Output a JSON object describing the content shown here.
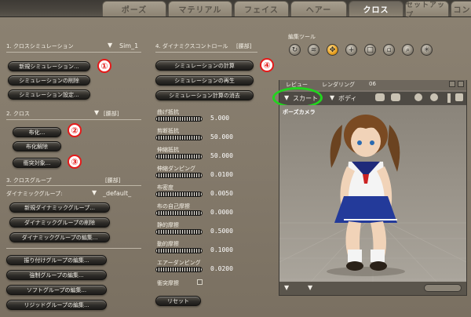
{
  "tabs": [
    "ポーズ",
    "マテリアル",
    "フェイス",
    "ヘアー",
    "クロス",
    "セットアップ",
    "コンテ"
  ],
  "active_tab": "クロス",
  "cloth_sim": {
    "section": "1. クロスシミュレーション",
    "sim_value": "Sim_1",
    "buttons": [
      "新規シミュレーション...",
      "シミュレーションの削除",
      "シミュレーション設定..."
    ]
  },
  "cloth": {
    "section": "2. クロス",
    "figure": "[腰部]",
    "buttons": [
      "布化...",
      "布化解除",
      "衝突対象..."
    ]
  },
  "cloth_group": {
    "section": "3. クロスグループ",
    "figure": "[腰部]",
    "dynamic_label": "ダイナミックグループ:",
    "dynamic_value": "_default_",
    "buttons": [
      "新規ダイナミックグループ...",
      "ダイナミックグループの削除",
      "ダイナミックグループの編集..."
    ],
    "group_buttons": [
      "振り付けグループの編集...",
      "強制グループの編集...",
      "ソフトグループの編集...",
      "リジッドグループの編集..."
    ]
  },
  "dynamics": {
    "section": "4. ダイナミクスコントロール",
    "figure": "[腰部]",
    "buttons": [
      "シミュレーションの計算",
      "シミュレーションの再生",
      "シミュレーション計算の消去"
    ],
    "params": [
      {
        "label": "曲げ抵抗",
        "value": "5.000"
      },
      {
        "label": "剪断抵抗",
        "value": "50.000"
      },
      {
        "label": "伸縮抵抗",
        "value": "50.000"
      },
      {
        "label": "伸縮ダンピング",
        "value": "0.0100"
      },
      {
        "label": "布密度",
        "value": "0.0050"
      },
      {
        "label": "布の自己摩擦",
        "value": "0.0000"
      },
      {
        "label": "静的摩擦",
        "value": "0.5000"
      },
      {
        "label": "動的摩擦",
        "value": "0.1000"
      },
      {
        "label": "エアーダンピング",
        "value": "0.0200"
      }
    ],
    "collision_label": "衝突摩擦",
    "reset_label": "リセット"
  },
  "edit_tools": {
    "label": "編集ツール"
  },
  "viewport": {
    "tabs": [
      "レビュー",
      "レンダリング",
      "06"
    ],
    "object_menu": "スカート",
    "figure_menu": "ボディ",
    "camera_label": "ポーズカメラ"
  },
  "badges": [
    "①",
    "②",
    "③",
    "④"
  ],
  "colors": {
    "background": "#857b6c",
    "button": "#2e2c28",
    "badge_ring": "#e41a1a",
    "highlight_ring": "#22d41f",
    "active_tool": "#e8a020"
  }
}
